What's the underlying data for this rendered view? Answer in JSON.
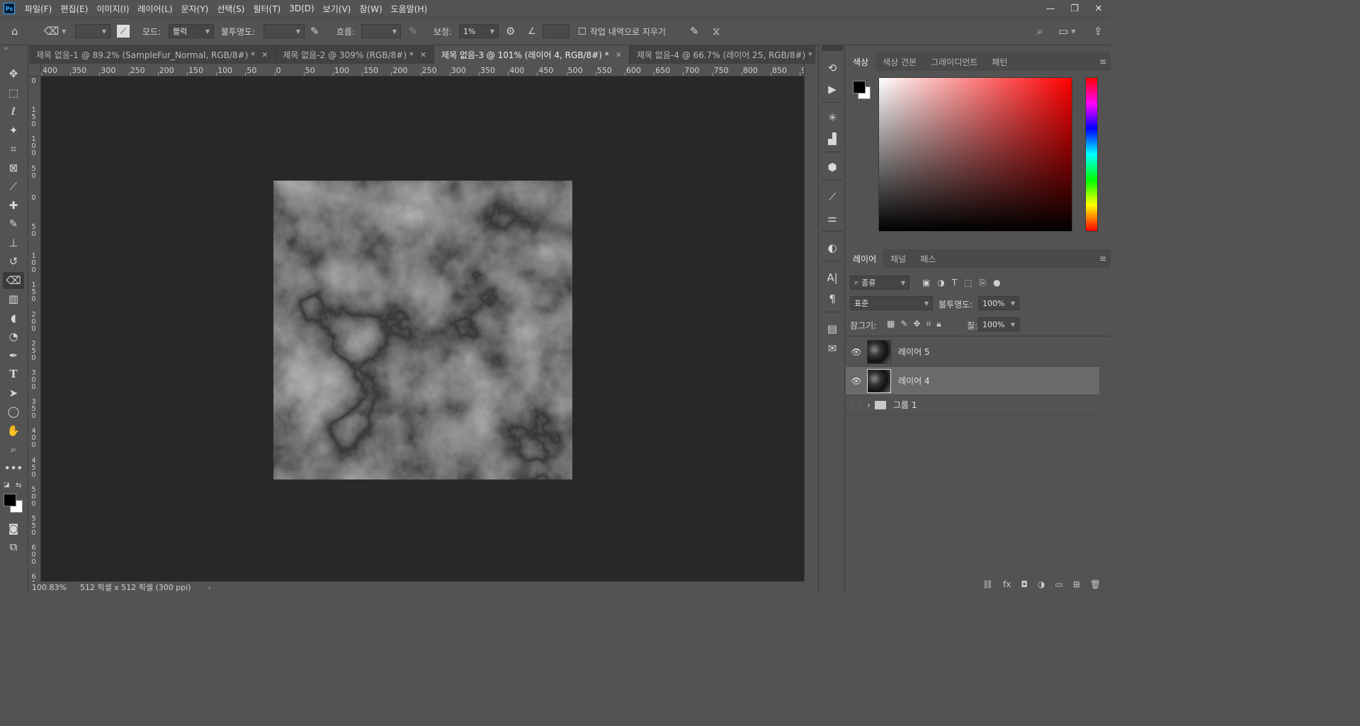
{
  "app": {
    "logo": "Ps"
  },
  "menu": [
    "파일(F)",
    "편집(E)",
    "이미지(I)",
    "레이어(L)",
    "문자(Y)",
    "선택(S)",
    "필터(T)",
    "3D(D)",
    "보기(V)",
    "창(W)",
    "도움말(H)"
  ],
  "options": {
    "mode_label": "모드:",
    "mode_value": "블럭",
    "opacity_label": "불투명도:",
    "flow_label": "흐름:",
    "smoothing_label": "보정:",
    "smoothing_value": "1%",
    "erase_history_label": "작업 내역으로 지우기"
  },
  "tabs": [
    {
      "label": "제목 없음-1 @ 89.2% (SampleFur_Normal, RGB/8#) *",
      "active": false
    },
    {
      "label": "제목 없음-2 @ 309% (RGB/8#) *",
      "active": false
    },
    {
      "label": "제목 없음-3 @ 101% (레이어 4, RGB/8#) *",
      "active": true
    },
    {
      "label": "제목 없음-4 @ 66.7% (레이어 25, RGB/8#) *",
      "active": false
    }
  ],
  "ruler_h": [
    "400",
    "350",
    "300",
    "250",
    "200",
    "150",
    "100",
    "50",
    "0",
    "50",
    "100",
    "150",
    "200",
    "250",
    "300",
    "350",
    "400",
    "450",
    "500",
    "550",
    "600",
    "650",
    "700",
    "750",
    "800",
    "850",
    "9"
  ],
  "ruler_v": [
    "0",
    "150",
    "100",
    "50",
    "0",
    "50",
    "100",
    "150",
    "200",
    "250",
    "300",
    "350",
    "400",
    "450",
    "500",
    "550",
    "600",
    "650"
  ],
  "status": {
    "zoom": "100.83%",
    "doc_info": "512 픽셀 x 512 픽셀 (300 ppi)"
  },
  "color_panel": {
    "tabs": [
      "색상",
      "색상 견본",
      "그레이디언트",
      "패턴"
    ],
    "foreground": "#000000",
    "background": "#ffffff"
  },
  "layers_panel": {
    "tabs": [
      "레이어",
      "채널",
      "패스"
    ],
    "filter_label": "종류",
    "blend_mode": "표준",
    "opacity_label": "불투명도:",
    "opacity_value": "100%",
    "lock_label": "잠그기:",
    "fill_label": "칠:",
    "fill_value": "100%",
    "layers": [
      {
        "name": "레이어 5",
        "visible": true,
        "selected": false,
        "type": "pixel"
      },
      {
        "name": "레이어 4",
        "visible": true,
        "selected": true,
        "type": "pixel"
      },
      {
        "name": "그룹 1",
        "visible": false,
        "selected": false,
        "type": "group"
      }
    ]
  },
  "tools": [
    "move-icon",
    "marquee-icon",
    "lasso-icon",
    "magic-wand-icon",
    "crop-icon",
    "frame-icon",
    "eyedropper-icon",
    "healing-icon",
    "brush-icon",
    "stamp-icon",
    "history-brush-icon",
    "eraser-icon",
    "gradient-icon",
    "blur-icon",
    "dodge-icon",
    "pen-icon",
    "type-icon",
    "path-select-icon",
    "ellipse-icon",
    "hand-icon",
    "zoom-icon",
    "more-icon"
  ]
}
